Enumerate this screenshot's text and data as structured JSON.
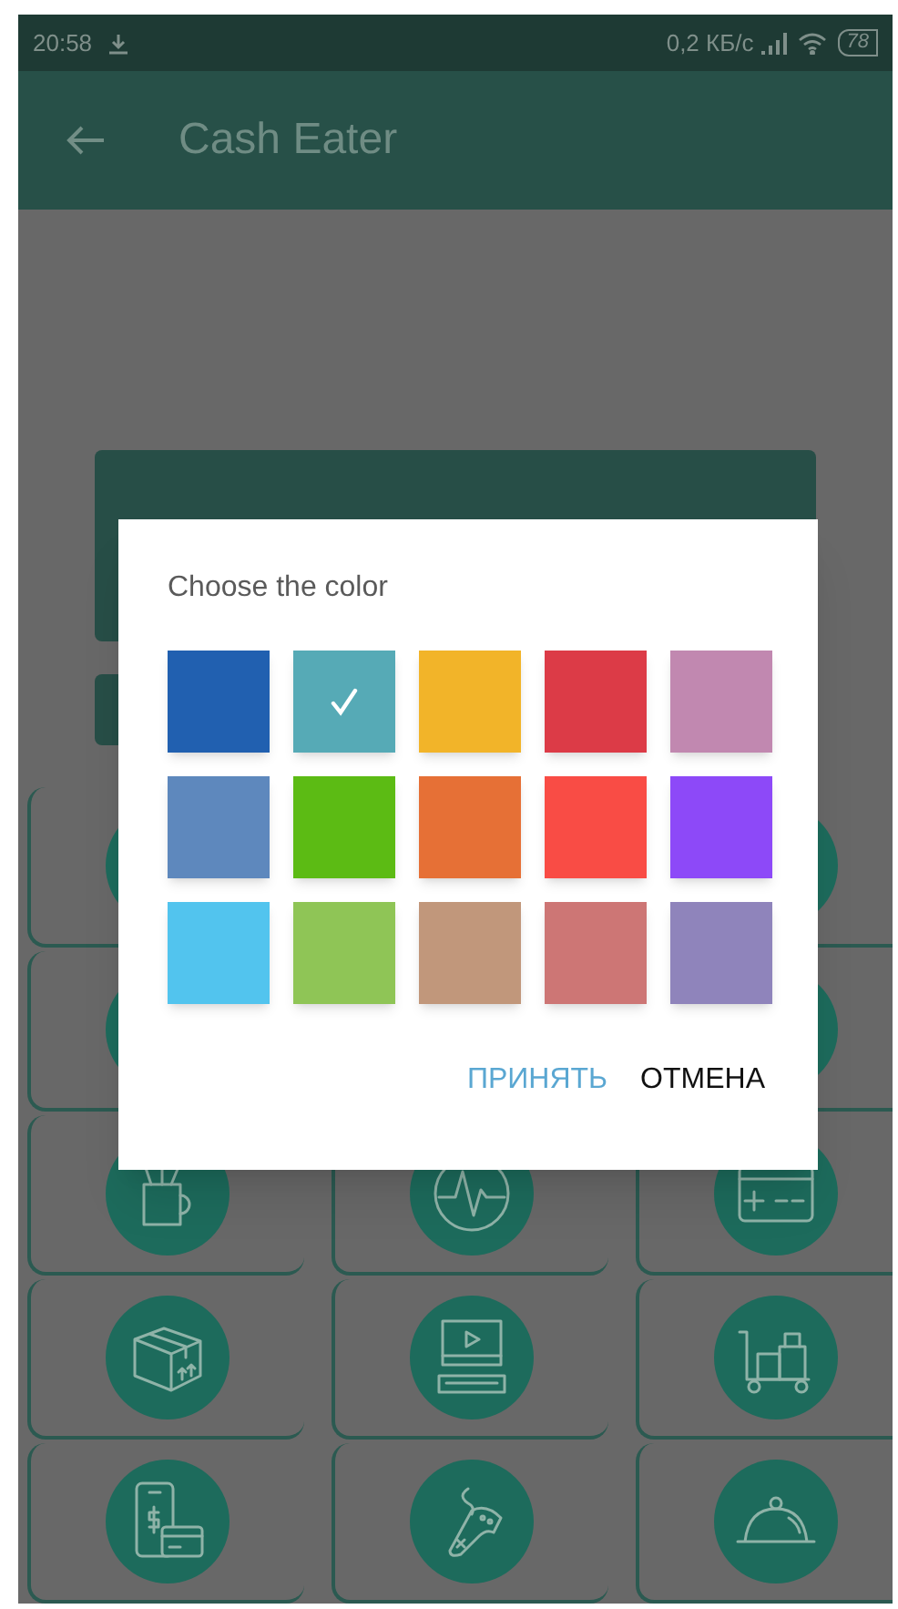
{
  "status_bar": {
    "time": "20:58",
    "speed": "0,2 КБ/с",
    "battery": "78"
  },
  "app_bar": {
    "title": "Cash Eater"
  },
  "dialog": {
    "title": "Choose the color",
    "swatches": [
      {
        "color": "#2160b0",
        "selected": false
      },
      {
        "color": "#56aab6",
        "selected": true
      },
      {
        "color": "#f2b429",
        "selected": false
      },
      {
        "color": "#dc3b47",
        "selected": false
      },
      {
        "color": "#c188b0",
        "selected": false
      },
      {
        "color": "#5e88bd",
        "selected": false
      },
      {
        "color": "#5cbb14",
        "selected": false
      },
      {
        "color": "#e67036",
        "selected": false
      },
      {
        "color": "#f94c45",
        "selected": false
      },
      {
        "color": "#8d49f8",
        "selected": false
      },
      {
        "color": "#52c4ee",
        "selected": false
      },
      {
        "color": "#8fc556",
        "selected": false
      },
      {
        "color": "#c1977b",
        "selected": false
      },
      {
        "color": "#cd7675",
        "selected": false
      },
      {
        "color": "#8f84bb",
        "selected": false
      }
    ],
    "buttons": [
      {
        "label": "ПРИНЯТЬ",
        "kind": "accept"
      },
      {
        "label": "ОТМЕНА",
        "kind": "cancel"
      }
    ]
  },
  "categories": [
    {
      "kind": "hidden"
    },
    {
      "kind": "covered"
    },
    {
      "kind": "hidden"
    },
    {
      "kind": "hidden"
    },
    {
      "kind": "covered"
    },
    {
      "kind": "hidden"
    },
    {
      "kind": "mug"
    },
    {
      "kind": "pulse"
    },
    {
      "kind": "card"
    },
    {
      "kind": "box"
    },
    {
      "kind": "computer"
    },
    {
      "kind": "cart"
    },
    {
      "kind": "phone"
    },
    {
      "kind": "gamepad"
    },
    {
      "kind": "cloche"
    }
  ]
}
